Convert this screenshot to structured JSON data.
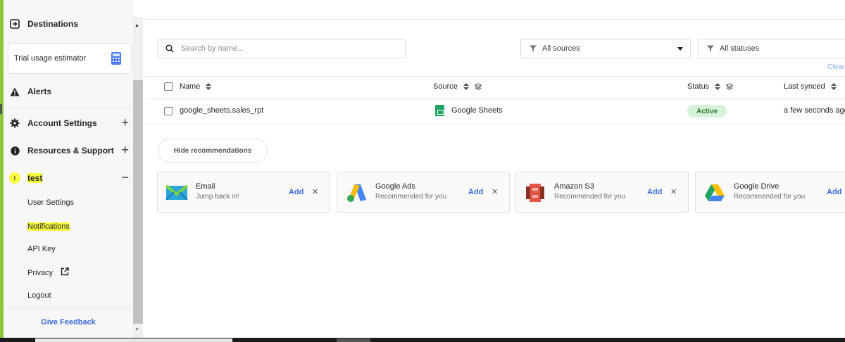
{
  "sidebar": {
    "destinations": "Destinations",
    "trial_usage": "Trial usage estimator",
    "alerts": "Alerts",
    "account_settings": "Account Settings",
    "resources_support": "Resources & Support",
    "user_avatar_initial": "t",
    "user_name": "test",
    "plus": "+",
    "minus": "−",
    "sub_items": [
      "User Settings",
      "Notifications",
      "API Key",
      "Privacy",
      "Logout"
    ],
    "give_feedback": "Give Feedback",
    "highlight_color": "#f8fb3c"
  },
  "toolbar": {
    "search_placeholder": "Search by name...",
    "filter_sources": "All sources",
    "filter_statuses": "All statuses",
    "clear": "Clear"
  },
  "table": {
    "columns": [
      "Name",
      "Source",
      "Status",
      "Last synced"
    ],
    "rows": [
      {
        "name": "google_sheets.sales_rpt",
        "source": "Google Sheets",
        "status": "Active",
        "last_synced": "a few seconds ago"
      }
    ]
  },
  "recommendations": {
    "hide_label": "Hide recommendations",
    "add_label": "Add",
    "close_glyph": "✕",
    "cards": [
      {
        "title": "Email",
        "subtitle": "Jump back in!",
        "icon": "email-icon"
      },
      {
        "title": "Google Ads",
        "subtitle": "Recommended for you",
        "icon": "google-ads-icon"
      },
      {
        "title": "Amazon S3",
        "subtitle": "Recommended for you",
        "icon": "amazon-s3-icon"
      },
      {
        "title": "Google Drive",
        "subtitle": "Recommended for you",
        "icon": "google-drive-icon"
      }
    ]
  },
  "colors": {
    "accent": "#3d6ad6",
    "active_badge_bg": "#d8f1da",
    "active_badge_text": "#2f7a36",
    "frame_green": "#8cc63f"
  }
}
